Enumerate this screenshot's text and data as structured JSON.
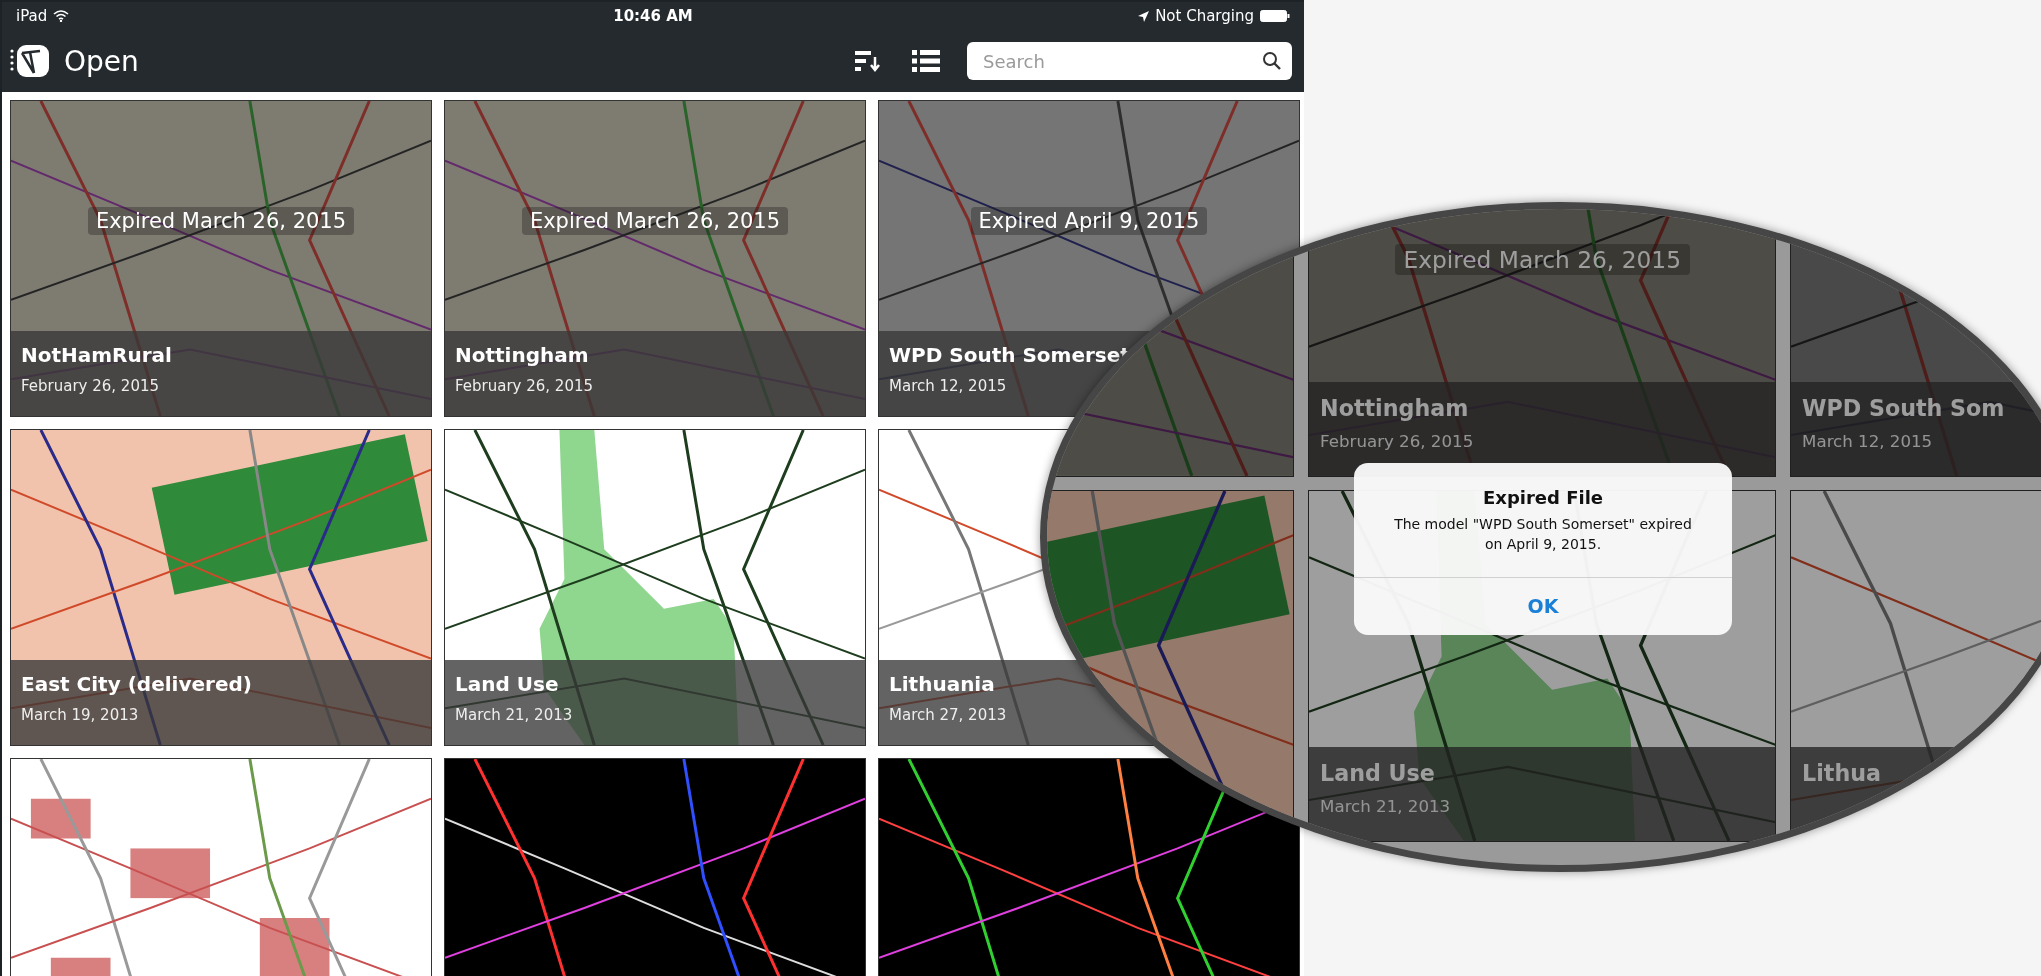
{
  "status_bar": {
    "device": "iPad",
    "time": "10:46 AM",
    "battery_status": "Not Charging"
  },
  "nav_bar": {
    "title": "Open",
    "search": {
      "placeholder": "Search"
    }
  },
  "tiles": [
    {
      "title": "NotHamRural",
      "date": "February 26, 2015",
      "expired": true,
      "expired_note": "Expired March 26, 2015"
    },
    {
      "title": "Nottingham",
      "date": "February 26, 2015",
      "expired": true,
      "expired_note": "Expired March 26, 2015"
    },
    {
      "title": "WPD South Somerset",
      "date": "March 12, 2015",
      "expired": true,
      "expired_note": "Expired April 9, 2015"
    },
    {
      "title": "East City (delivered)",
      "date": "March 19, 2013",
      "expired": false
    },
    {
      "title": "Land Use",
      "date": "March 21, 2013",
      "expired": false
    },
    {
      "title": "Lithuania",
      "date": "March 27, 2013",
      "expired": false
    },
    {
      "expired": false
    },
    {
      "expired": false
    },
    {
      "expired": false
    }
  ],
  "magnifier": {
    "tiles": [
      {
        "expired": true
      },
      {
        "expired": true,
        "expired_note": "Expired March 26, 2015",
        "title": "Nottingham",
        "date": "February 26, 2015"
      },
      {
        "expired": true,
        "title": "WPD South Som",
        "date": "March 12, 2015"
      },
      {
        "expired": false
      },
      {
        "expired": false,
        "title": "Land Use",
        "date": "March 21, 2013"
      },
      {
        "expired": false,
        "title": "Lithua"
      }
    ],
    "alert": {
      "title": "Expired File",
      "message": "The model \"WPD South Somerset\" expired on April 9, 2015.",
      "button": "OK"
    }
  }
}
